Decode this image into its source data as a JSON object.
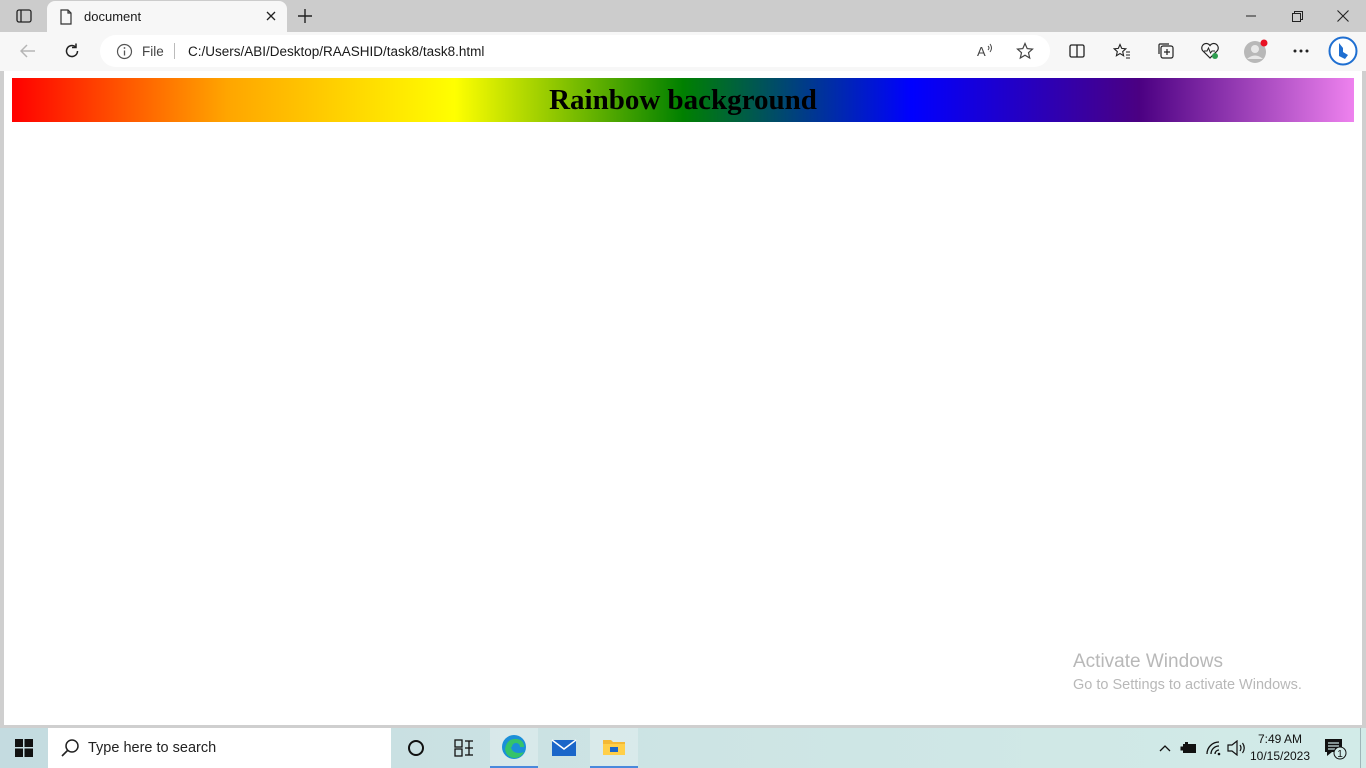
{
  "browser": {
    "tab_title": "document",
    "address_scheme_label": "File",
    "url": "C:/Users/ABI/Desktop/RAASHID/task8/task8.html"
  },
  "page": {
    "header_text": "Rainbow background",
    "gradient_colors": [
      "#ff0000",
      "#ffa500",
      "#ffff00",
      "#008000",
      "#0000ff",
      "#4b0082",
      "#ee82ee"
    ]
  },
  "watermark": {
    "title": "Activate Windows",
    "subtitle": "Go to Settings to activate Windows."
  },
  "taskbar": {
    "search_placeholder": "Type here to search",
    "pinned": [
      "task-view-icon",
      "widgets-icon",
      "edge-icon",
      "mail-icon",
      "file-explorer-icon"
    ],
    "clock_time": "7:49 AM",
    "clock_date": "10/15/2023",
    "notification_count": "1"
  },
  "colors": {
    "accent": "#0078d4",
    "tab_bar": "#cccccc",
    "toolbar": "#f7f7f7"
  }
}
